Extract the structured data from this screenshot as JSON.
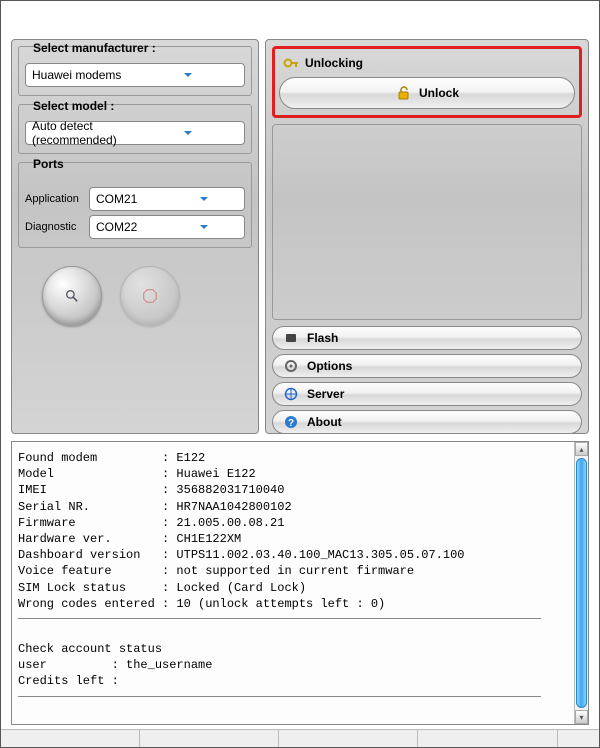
{
  "left": {
    "manufacturer_group_label": "Select manufacturer :",
    "manufacturer_value": "Huawei modems",
    "model_group_label": "Select model :",
    "model_value": "Auto detect (recommended)",
    "ports_group_label": "Ports",
    "ports": {
      "application_label": "Application",
      "application_value": "COM21",
      "diagnostic_label": "Diagnostic",
      "diagnostic_value": "COM22"
    }
  },
  "right": {
    "unlocking_header": "Unlocking",
    "unlock_button": "Unlock",
    "sections": {
      "flash": "Flash",
      "options": "Options",
      "server": "Server",
      "about": "About"
    }
  },
  "log": {
    "block1": "Found modem         : E122\nModel               : Huawei E122\nIMEI                : 356882031710040\nSerial NR.          : HR7NAA1042800102\nFirmware            : 21.005.00.08.21\nHardware ver.       : CH1E122XM\nDashboard version   : UTPS11.002.03.40.100_MAC13.305.05.07.100\nVoice feature       : not supported in current firmware\nSIM Lock status     : Locked (Card Lock)\nWrong codes entered : 10 (unlock attempts left : 0)",
    "block2": "Check account status\nuser         : the_username\nCredits left :"
  }
}
